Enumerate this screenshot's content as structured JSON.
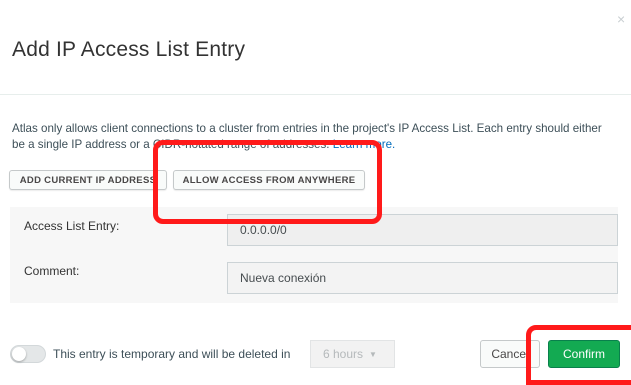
{
  "dialog": {
    "title": "Add IP Access List Entry",
    "close_glyph": "×",
    "intro_text": "Atlas only allows client connections to a cluster from entries in the project's IP Access List. Each entry should either be a single IP address or a CIDR-notated range of addresses.",
    "learn_more_label": "Learn more."
  },
  "buttons": {
    "add_current_ip": "ADD CURRENT IP ADDRESS",
    "allow_anywhere": "ALLOW ACCESS FROM ANYWHERE",
    "cancel": "Cancel",
    "confirm": "Confirm"
  },
  "form": {
    "access_list_entry_label": "Access List Entry:",
    "access_list_entry_value": "0.0.0.0/0",
    "comment_label": "Comment:",
    "comment_value": "Nueva conexión"
  },
  "footer": {
    "temporary_text": "This entry is temporary and will be deleted in",
    "temporary_toggle_on": false,
    "duration_selected": "6 hours",
    "duration_caret": "▼"
  },
  "colors": {
    "confirm_green": "#13aa52",
    "link_blue": "#006cbc",
    "annotation_red": "#ff1a1a"
  },
  "icons": {
    "close": "close-icon",
    "dropdown": "chevron-down-icon"
  }
}
